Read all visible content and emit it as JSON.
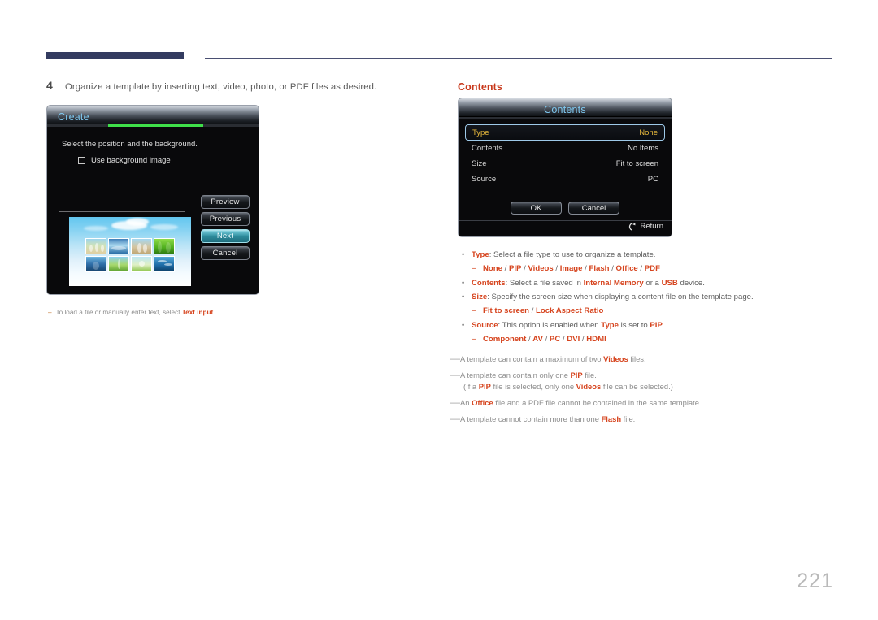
{
  "header": {
    "rule_color": "#333b60"
  },
  "step": {
    "number": "4",
    "text": "Organize a template by inserting text, video, photo, or PDF files as desired."
  },
  "create_dialog": {
    "title": "Create",
    "progress_percent": 45,
    "hint": "Select the position and the background.",
    "checkbox_label": "Use background image",
    "checkbox_checked": false,
    "buttons": [
      {
        "label": "Preview",
        "selected": false
      },
      {
        "label": "Previous",
        "selected": false
      },
      {
        "label": "Next",
        "selected": true
      },
      {
        "label": "Cancel",
        "selected": false
      }
    ]
  },
  "left_note": {
    "dash": "–",
    "pre": "To load a file or manually enter text, select ",
    "keyword": "Text input",
    "post": "."
  },
  "right": {
    "section_title": "Contents",
    "contents_dialog": {
      "title": "Contents",
      "rows": [
        {
          "label": "Type",
          "value": "None",
          "highlighted": true
        },
        {
          "label": "Contents",
          "value": "No Items",
          "highlighted": false
        },
        {
          "label": "Size",
          "value": "Fit to screen",
          "highlighted": false
        },
        {
          "label": "Source",
          "value": "PC",
          "highlighted": false
        }
      ],
      "ok_label": "OK",
      "cancel_label": "Cancel",
      "return_label": "Return"
    },
    "bullets": [
      {
        "dot": "•",
        "keyword": "Type",
        "text": ": Select a file type to use to organize a template.",
        "sub": {
          "dash": "–",
          "options": [
            "None",
            "PIP",
            "Videos",
            "Image",
            "Flash",
            "Office",
            "PDF"
          ]
        }
      },
      {
        "dot": "•",
        "keyword": "Contents",
        "text_parts": [
          {
            "t": ": Select a file saved in ",
            "kw": false
          },
          {
            "t": "Internal Memory",
            "kw": true
          },
          {
            "t": " or a ",
            "kw": false
          },
          {
            "t": "USB",
            "kw": true
          },
          {
            "t": " device.",
            "kw": false
          }
        ]
      },
      {
        "dot": "•",
        "keyword": "Size",
        "text": ": Specify the screen size when displaying a content file on the template page.",
        "sub": {
          "dash": "–",
          "options": [
            "Fit to screen",
            "Lock Aspect Ratio"
          ]
        }
      },
      {
        "dot": "•",
        "keyword": "Source",
        "text_parts": [
          {
            "t": ": This option is enabled when ",
            "kw": false
          },
          {
            "t": "Type",
            "kw": true
          },
          {
            "t": " is set to ",
            "kw": false
          },
          {
            "t": "PIP",
            "kw": true
          },
          {
            "t": ".",
            "kw": false
          }
        ],
        "sub": {
          "dash": "–",
          "options": [
            "Component",
            "AV",
            "PC",
            "DVI",
            "HDMI"
          ]
        }
      }
    ],
    "notes": [
      {
        "dash": "—",
        "parts": [
          {
            "t": "A template can contain a maximum of two ",
            "kw": false
          },
          {
            "t": "Videos",
            "kw": true
          },
          {
            "t": " files.",
            "kw": false
          }
        ]
      },
      {
        "dash": "—",
        "parts": [
          {
            "t": "A template can contain only one ",
            "kw": false
          },
          {
            "t": "PIP",
            "kw": true
          },
          {
            "t": " file.",
            "kw": false
          }
        ],
        "sub_parts": [
          {
            "t": "(If a ",
            "kw": false
          },
          {
            "t": "PIP",
            "kw": true
          },
          {
            "t": " file is selected, only one ",
            "kw": false
          },
          {
            "t": "Videos",
            "kw": true
          },
          {
            "t": " file can be selected.)",
            "kw": false
          }
        ]
      },
      {
        "dash": "—",
        "parts": [
          {
            "t": "An ",
            "kw": false
          },
          {
            "t": "Office",
            "kw": true
          },
          {
            "t": " file and a PDF file cannot be contained in the same template.",
            "kw": false
          }
        ]
      },
      {
        "dash": "—",
        "parts": [
          {
            "t": "A template cannot contain more than one ",
            "kw": false
          },
          {
            "t": "Flash",
            "kw": true
          },
          {
            "t": " file.",
            "kw": false
          }
        ]
      }
    ]
  },
  "page_number": "221",
  "colors": {
    "keyword_red": "#d6441e",
    "section_red": "#c8381b",
    "header_navy": "#333b60",
    "dialog_title_blue": "#7fc8ef",
    "selected_row_gold": "#e8b93c",
    "progress_green": "#3fe04a"
  }
}
